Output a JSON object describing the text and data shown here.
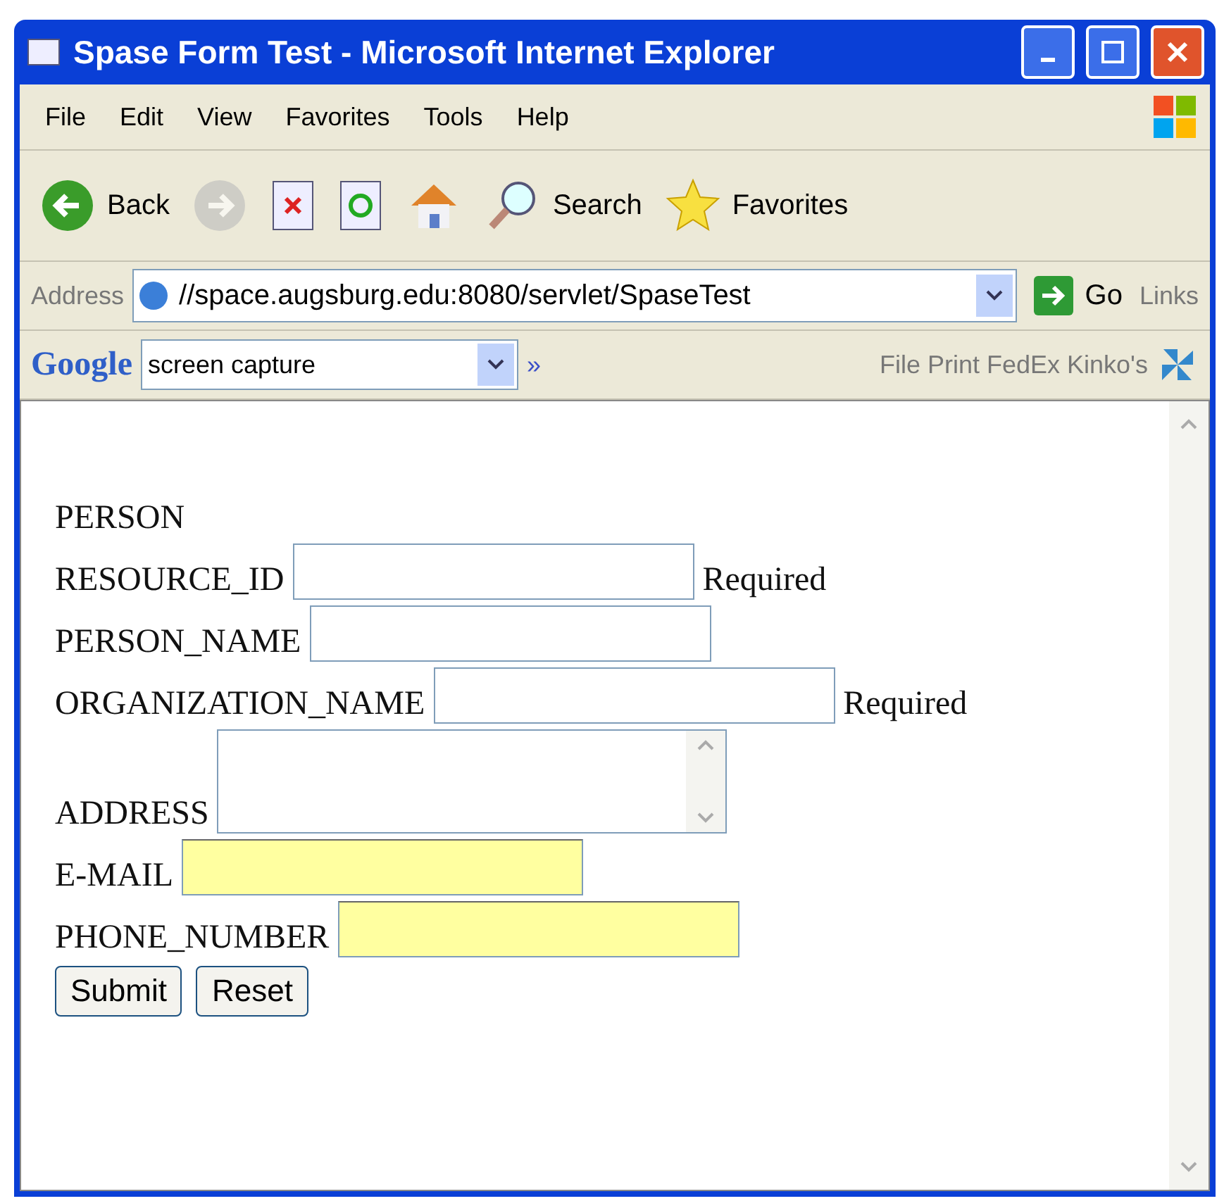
{
  "window": {
    "title": "Spase Form Test - Microsoft Internet Explorer"
  },
  "menu": [
    "File",
    "Edit",
    "View",
    "Favorites",
    "Tools",
    "Help"
  ],
  "toolbar": [
    {
      "kind": "back",
      "label": "Back",
      "disabled": false
    },
    {
      "kind": "forward",
      "disabled": true
    },
    {
      "kind": "stop",
      "disabled": false
    },
    {
      "kind": "refresh",
      "disabled": false
    },
    {
      "kind": "home",
      "disabled": false
    },
    {
      "kind": "search",
      "label": "Search",
      "disabled": false
    },
    {
      "kind": "favorites",
      "label": "Favorites",
      "disabled": false
    }
  ],
  "address_bar": {
    "label": "Address",
    "value": "//space.augsburg.edu:8080/servlet/SpaseTest",
    "go": "Go",
    "links": "Links"
  },
  "google_bar": {
    "logo": "Google",
    "value": "screen capture",
    "more": "»",
    "links": "File Print FedEx Kinko's"
  },
  "form": {
    "heading": "PERSON",
    "fields": [
      {
        "label": "RESOURCE_ID",
        "kind": "text",
        "highlighted": false,
        "note": "Required"
      },
      {
        "label": "PERSON_NAME",
        "kind": "text",
        "highlighted": false
      },
      {
        "label": "ORGANIZATION_NAME",
        "kind": "text",
        "highlighted": false,
        "note": "Required"
      },
      {
        "label": "ADDRESS",
        "kind": "textarea",
        "highlighted": false
      },
      {
        "label": "E-MAIL",
        "kind": "text",
        "highlighted": true
      },
      {
        "label": "PHONE_NUMBER",
        "kind": "text",
        "highlighted": true
      }
    ],
    "buttons": [
      "Submit",
      "Reset"
    ]
  }
}
